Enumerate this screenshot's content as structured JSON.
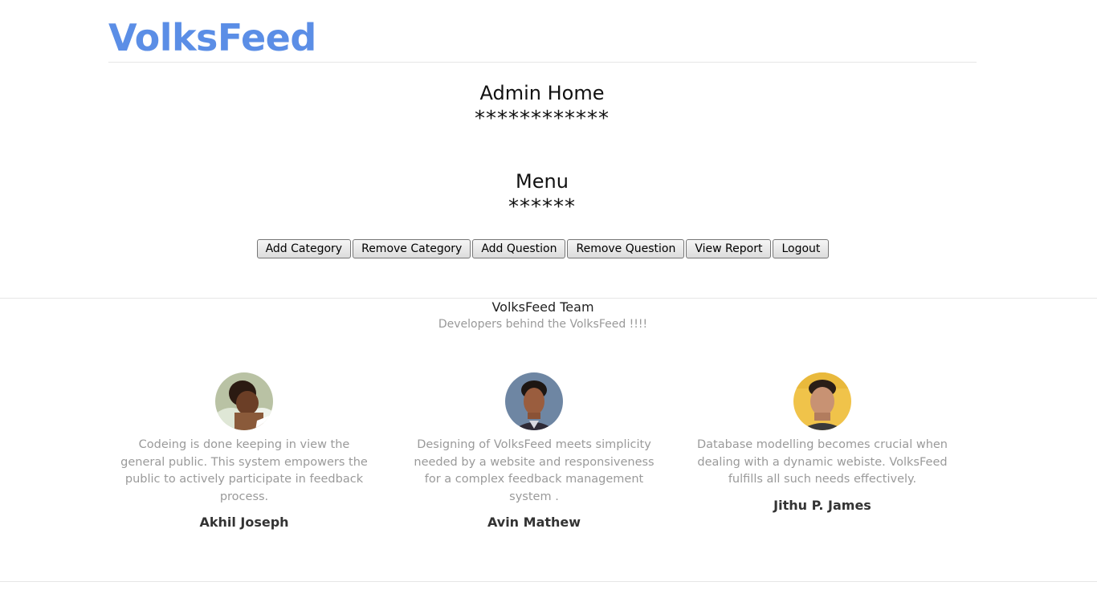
{
  "header": {
    "brand": "VolksFeed"
  },
  "main": {
    "title": "Admin Home",
    "title_stars": "************",
    "menu_title": "Menu",
    "menu_stars": "******",
    "buttons": [
      {
        "label": "Add Category"
      },
      {
        "label": "Remove Category"
      },
      {
        "label": "Add Question"
      },
      {
        "label": "Remove Question"
      },
      {
        "label": "View Report"
      },
      {
        "label": "Logout"
      }
    ]
  },
  "team": {
    "title": "VolksFeed Team",
    "subtitle": "Developers behind the VolksFeed !!!!",
    "members": [
      {
        "name": "Akhil Joseph",
        "desc": "Codeing is done keeping in view the general public. This system empowers the public to actively participate in feedback process."
      },
      {
        "name": "Avin Mathew",
        "desc": "Designing of VolksFeed meets simplicity needed by a website and responsiveness for a complex feedback management system ."
      },
      {
        "name": "Jithu P. James",
        "desc": "Database  modelling becomes crucial when dealing with a dynamic webiste. VolksFeed fulfills all such needs effectively."
      }
    ]
  },
  "colors": {
    "brand": "#5b8ee6",
    "muted_text": "#9a9a9a"
  }
}
